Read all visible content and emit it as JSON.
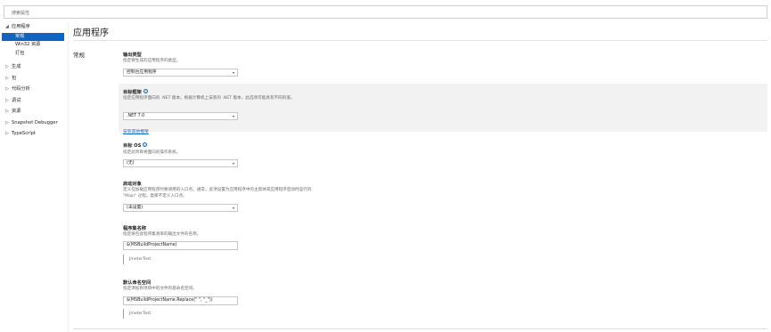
{
  "search": {
    "placeholder": "搜索属性"
  },
  "sidebar": {
    "groups": [
      {
        "label": "应用程序",
        "expanded": true,
        "children": [
          "常规",
          "Win32 资源",
          "打包"
        ],
        "selected_child": "常规"
      },
      {
        "label": "生成"
      },
      {
        "label": "包"
      },
      {
        "label": "代码分析"
      },
      {
        "label": "调试"
      },
      {
        "label": "资源"
      },
      {
        "label": "Snapshot Debugger"
      },
      {
        "label": "TypeScript"
      }
    ]
  },
  "page": {
    "title": "应用程序",
    "section": "常规"
  },
  "props": {
    "output_type": {
      "title": "输出类型",
      "desc": "指定要生成的应用程序的类型。",
      "value": "控制台应用程序"
    },
    "target_framework": {
      "title": "目标框架",
      "desc": "指定应用程序面向的 .NET 版本。根据计算机上安装的 .NET 版本，此选项可能具有不同的值。",
      "value": ".NET 7.0",
      "link": "安装其他框架"
    },
    "target_os": {
      "title": "目标 OS",
      "desc": "指定此项目将面向的操作系统。",
      "value": "(无)"
    },
    "startup_object": {
      "title": "启动对象",
      "desc": "定义在加载应用程序时要调用的入口点。通常，此项设置为应用程序中的主窗体或应用程序启动时运行的 \"Main\" 过程。类库不定义入口点。",
      "value": "(未设置)"
    },
    "assembly_name": {
      "title": "程序集名称",
      "desc": "指定将包含程序集清单的输出文件的名称。",
      "value": "$(MSBuildProjectName)",
      "preview": "JmeterTest"
    },
    "default_namespace": {
      "title": "默认命名空间",
      "desc": "指定添加到项目中的文件的基命名空间。",
      "value": "$(MSBuildProjectName.Replace(\" \", \"_\"))",
      "preview": "JmeterTest"
    }
  },
  "colors": {
    "accent": "#0e64bf",
    "shaded_row": "#f2f2f2"
  },
  "icons": {
    "expand": "triangle-down",
    "collapse": "triangle-right",
    "info": "info-circle",
    "dropdown": "chevron-down"
  }
}
